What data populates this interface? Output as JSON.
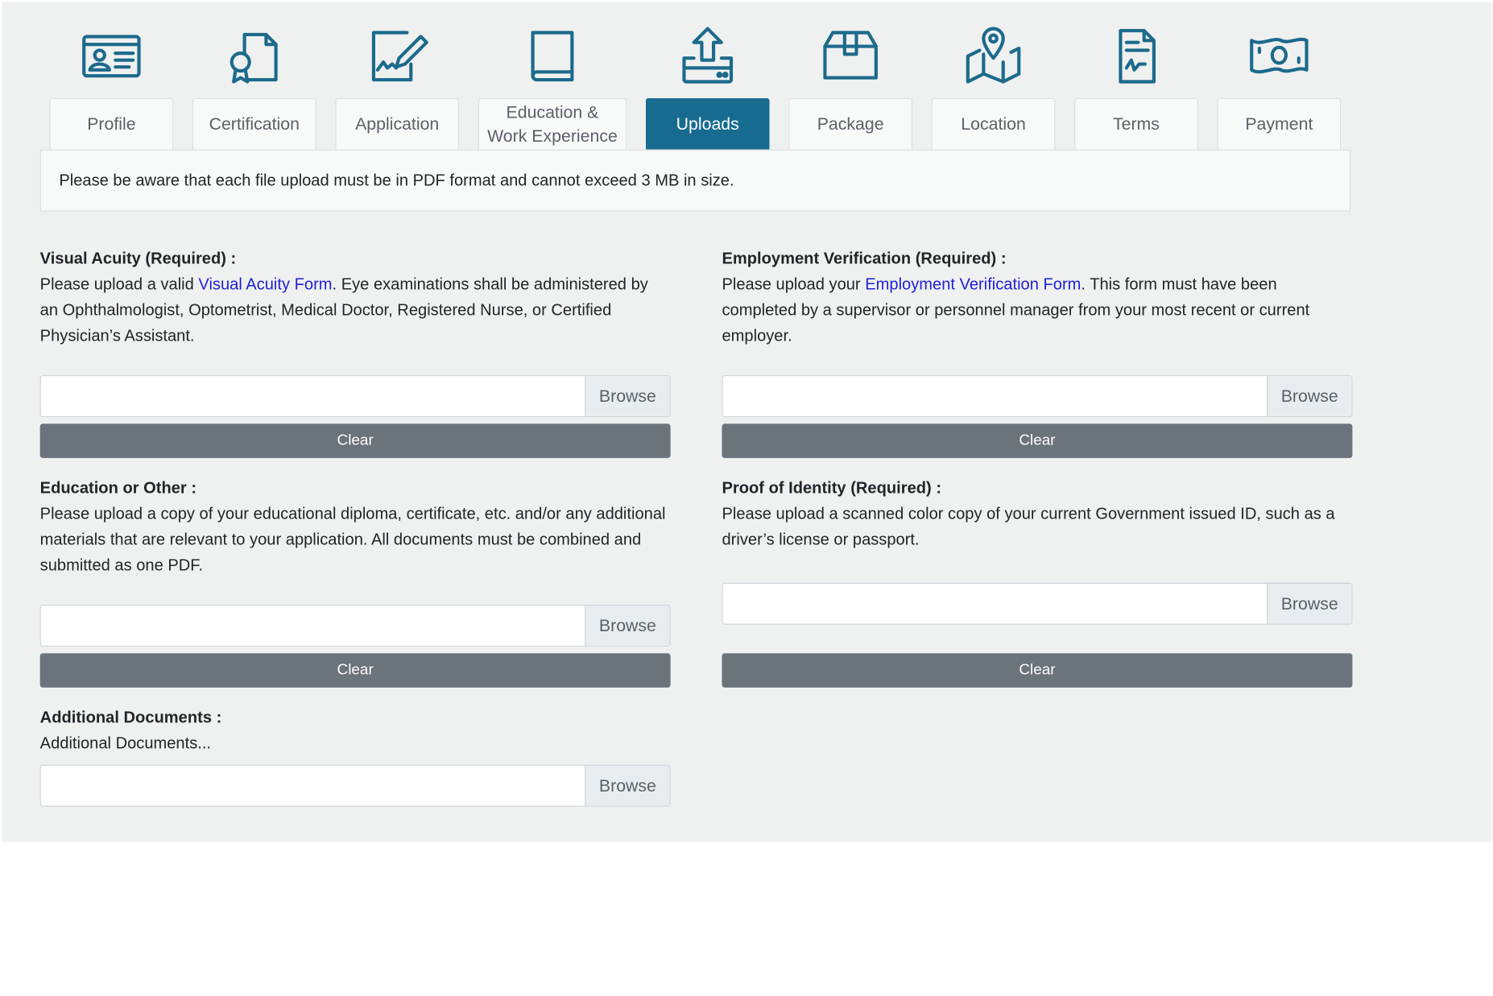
{
  "tabs": [
    {
      "id": "profile",
      "label": "Profile",
      "icon": "id-card-icon",
      "active": false
    },
    {
      "id": "certification",
      "label": "Certification",
      "icon": "certificate-icon",
      "active": false
    },
    {
      "id": "application",
      "label": "Application",
      "icon": "signed-document-icon",
      "active": false
    },
    {
      "id": "education",
      "label": "Education & Work Experience",
      "icon": "book-icon",
      "active": false
    },
    {
      "id": "uploads",
      "label": "Uploads",
      "icon": "upload-icon",
      "active": true
    },
    {
      "id": "package",
      "label": "Package",
      "icon": "package-icon",
      "active": false
    },
    {
      "id": "location",
      "label": "Location",
      "icon": "map-location-icon",
      "active": false
    },
    {
      "id": "terms",
      "label": "Terms",
      "icon": "terms-document-icon",
      "active": false
    },
    {
      "id": "payment",
      "label": "Payment",
      "icon": "money-icon",
      "active": false
    }
  ],
  "notice": "Please be aware that each file upload must be in PDF format and cannot exceed 3 MB in size.",
  "browse_label": "Browse",
  "clear_label": "Clear",
  "colors": {
    "active_tab": "#176b90",
    "icon": "#1c6a8c",
    "link": "#1f1fd6",
    "clear_button": "#6b737b"
  },
  "sections": {
    "visual_acuity": {
      "title": "Visual Acuity (Required) :",
      "desc_before": "Please upload a valid ",
      "link": "Visual Acuity Form",
      "desc_after": ". Eye examinations shall be administered by an Ophthalmologist, Optometrist, Medical Doctor, Registered Nurse, or Certified Physician’s Assistant.",
      "file_value": ""
    },
    "employment": {
      "title": "Employment Verification (Required) :",
      "desc_before": "Please upload your ",
      "link": "Employment Verification Form",
      "desc_after": ". This form must have been completed by a supervisor or personnel manager from your most recent or current employer.",
      "file_value": ""
    },
    "education": {
      "title": "Education or Other :",
      "desc": "Please upload a copy of your educational diploma, certificate, etc. and/or any additional materials that are relevant to your application. All documents must be combined and submitted as one PDF.",
      "file_value": ""
    },
    "identity": {
      "title": "Proof of Identity (Required) :",
      "desc": "Please upload a scanned color copy of your current Government issued ID, such as a driver’s license or passport.",
      "file_value": ""
    },
    "additional": {
      "title": "Additional Documents :",
      "desc": "Additional Documents...",
      "file_value": ""
    }
  }
}
